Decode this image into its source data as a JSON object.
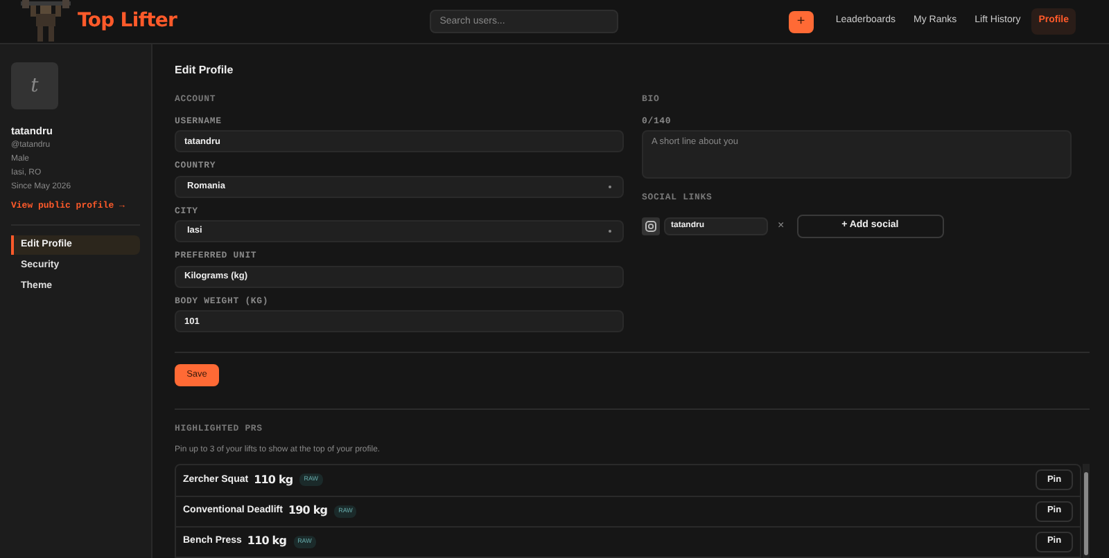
{
  "header": {
    "brand": "Top Lifter",
    "search": {
      "placeholder": "Search users..."
    },
    "add_button": "+",
    "nav": [
      {
        "label": "Leaderboards",
        "selected": false
      },
      {
        "label": "My Ranks",
        "selected": false
      },
      {
        "label": "Lift History",
        "selected": false
      },
      {
        "label": "Profile",
        "selected": true
      }
    ]
  },
  "sidebar": {
    "avatar_letter": "t",
    "name": "tatandru",
    "handle": "@tatandru",
    "details": [
      "Male",
      "Iasi, RO",
      "Since May 2026"
    ],
    "public_link": "View public profile →",
    "items": [
      {
        "label": "Edit Profile",
        "selected": true
      },
      {
        "label": "Security",
        "selected": false
      },
      {
        "label": "Theme",
        "selected": false
      }
    ]
  },
  "main": {
    "title": "Edit Profile",
    "account": {
      "heading": "ACCOUNT",
      "fields": [
        {
          "label": "USERNAME",
          "kind": "input",
          "value": "tatandru"
        },
        {
          "label": "COUNTRY",
          "kind": "select",
          "value": "Romania"
        },
        {
          "label": "CITY",
          "kind": "select",
          "value": "Iasi"
        },
        {
          "label": "PREFERRED UNIT",
          "kind": "input",
          "value": "Kilograms (kg)"
        },
        {
          "label": "BODY WEIGHT (KG)",
          "kind": "input",
          "value": "101"
        }
      ]
    },
    "bio": {
      "heading": "BIO",
      "counter": "0/140",
      "placeholder": "A short line about you"
    },
    "social": {
      "heading": "SOCIAL LINKS",
      "links": [
        {
          "value": "tatandru",
          "remove": "×"
        }
      ],
      "add_button": "+ Add social"
    },
    "save_button": "Save",
    "highlighted": {
      "heading": "HIGHLIGHTED PRS",
      "description": "Pin up to 3 of your lifts to show at the top of your profile.",
      "rows": [
        {
          "lift": "Zercher Squat",
          "weight": "110 kg",
          "tag": "RAW",
          "button": "Pin"
        },
        {
          "lift": "Conventional Deadlift",
          "weight": "190 kg",
          "tag": "RAW",
          "button": "Pin"
        },
        {
          "lift": "Bench Press",
          "weight": "110 kg",
          "tag": "RAW",
          "button": "Pin"
        }
      ]
    }
  }
}
